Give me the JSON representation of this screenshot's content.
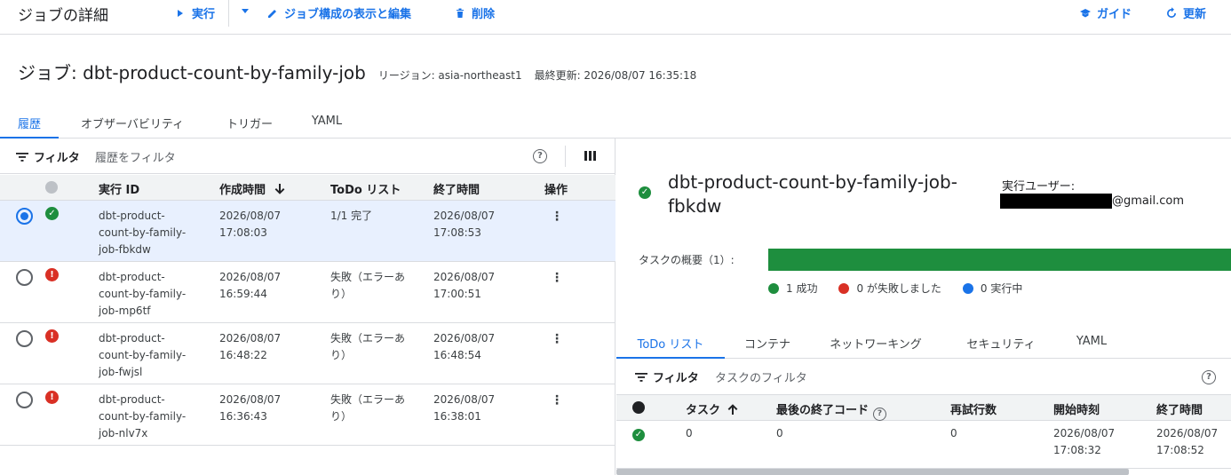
{
  "topbar": {
    "title": "ジョブの詳細",
    "run_label": "実行",
    "edit_label": "ジョブ構成の表示と編集",
    "delete_label": "削除",
    "guide_label": "ガイド",
    "refresh_label": "更新"
  },
  "job": {
    "title": "ジョブ: dbt-product-count-by-family-job",
    "region": "リージョン: asia-northeast1",
    "updated": "最終更新: 2026/08/07 16:35:18"
  },
  "tabs": [
    "履歴",
    "オブザーバビリティ",
    "トリガー",
    "YAML"
  ],
  "history": {
    "filter_label": "フィルタ",
    "filter_placeholder": "履歴をフィルタ",
    "columns": {
      "id": "実行 ID",
      "created": "作成時間",
      "todo": "ToDo リスト",
      "end": "終了時間",
      "ops": "操作"
    },
    "rows": [
      {
        "id_lines": [
          "dbt-product-",
          "count-by-family-",
          "job-fbkdw"
        ],
        "created": [
          "2026/08/07",
          "17:08:03"
        ],
        "todo": [
          "1/1 完了"
        ],
        "end": [
          "2026/08/07",
          "17:08:53"
        ],
        "status": "success",
        "selected": true
      },
      {
        "id_lines": [
          "dbt-product-",
          "count-by-family-",
          "job-mp6tf"
        ],
        "created": [
          "2026/08/07",
          "16:59:44"
        ],
        "todo": [
          "失敗（エラーあ",
          "り）"
        ],
        "end": [
          "2026/08/07",
          "17:00:51"
        ],
        "status": "error",
        "selected": false
      },
      {
        "id_lines": [
          "dbt-product-",
          "count-by-family-",
          "job-fwjsl"
        ],
        "created": [
          "2026/08/07",
          "16:48:22"
        ],
        "todo": [
          "失敗（エラーあ",
          "り）"
        ],
        "end": [
          "2026/08/07",
          "16:48:54"
        ],
        "status": "error",
        "selected": false
      },
      {
        "id_lines": [
          "dbt-product-",
          "count-by-family-",
          "job-nlv7x"
        ],
        "created": [
          "2026/08/07",
          "16:36:43"
        ],
        "todo": [
          "失敗（エラーあ",
          "り）"
        ],
        "end": [
          "2026/08/07",
          "16:38:01"
        ],
        "status": "error",
        "selected": false
      }
    ]
  },
  "execution": {
    "title_line1": "dbt-product-count-by-family-job-",
    "title_line2": "fbkdw",
    "user_label": "実行ユーザー:",
    "user_email_suffix": "@gmail.com",
    "summary_label": "タスクの概要（1）:",
    "progress_success_fraction": 1.0,
    "legend": {
      "success": "1 成功",
      "failed": "0 が失敗しました",
      "running": "0 実行中"
    },
    "tabs": [
      "ToDo リスト",
      "コンテナ",
      "ネットワーキング",
      "セキュリティ",
      "YAML"
    ],
    "filter_label": "フィルタ",
    "filter_placeholder": "タスクのフィルタ",
    "columns": {
      "task": "タスク",
      "exit_code": "最後の終了コード",
      "retries": "再試行数",
      "start": "開始時刻",
      "end": "終了時間"
    },
    "task_row": {
      "task": "0",
      "exit_code": "0",
      "retries": "0",
      "start": [
        "2026/08/07",
        "17:08:32"
      ],
      "end": [
        "2026/08/07",
        "17:08:52"
      ]
    }
  },
  "colors": {
    "accent": "#1a73e8",
    "success": "#1e8e3e",
    "error": "#d93025",
    "running": "#1a73e8"
  }
}
